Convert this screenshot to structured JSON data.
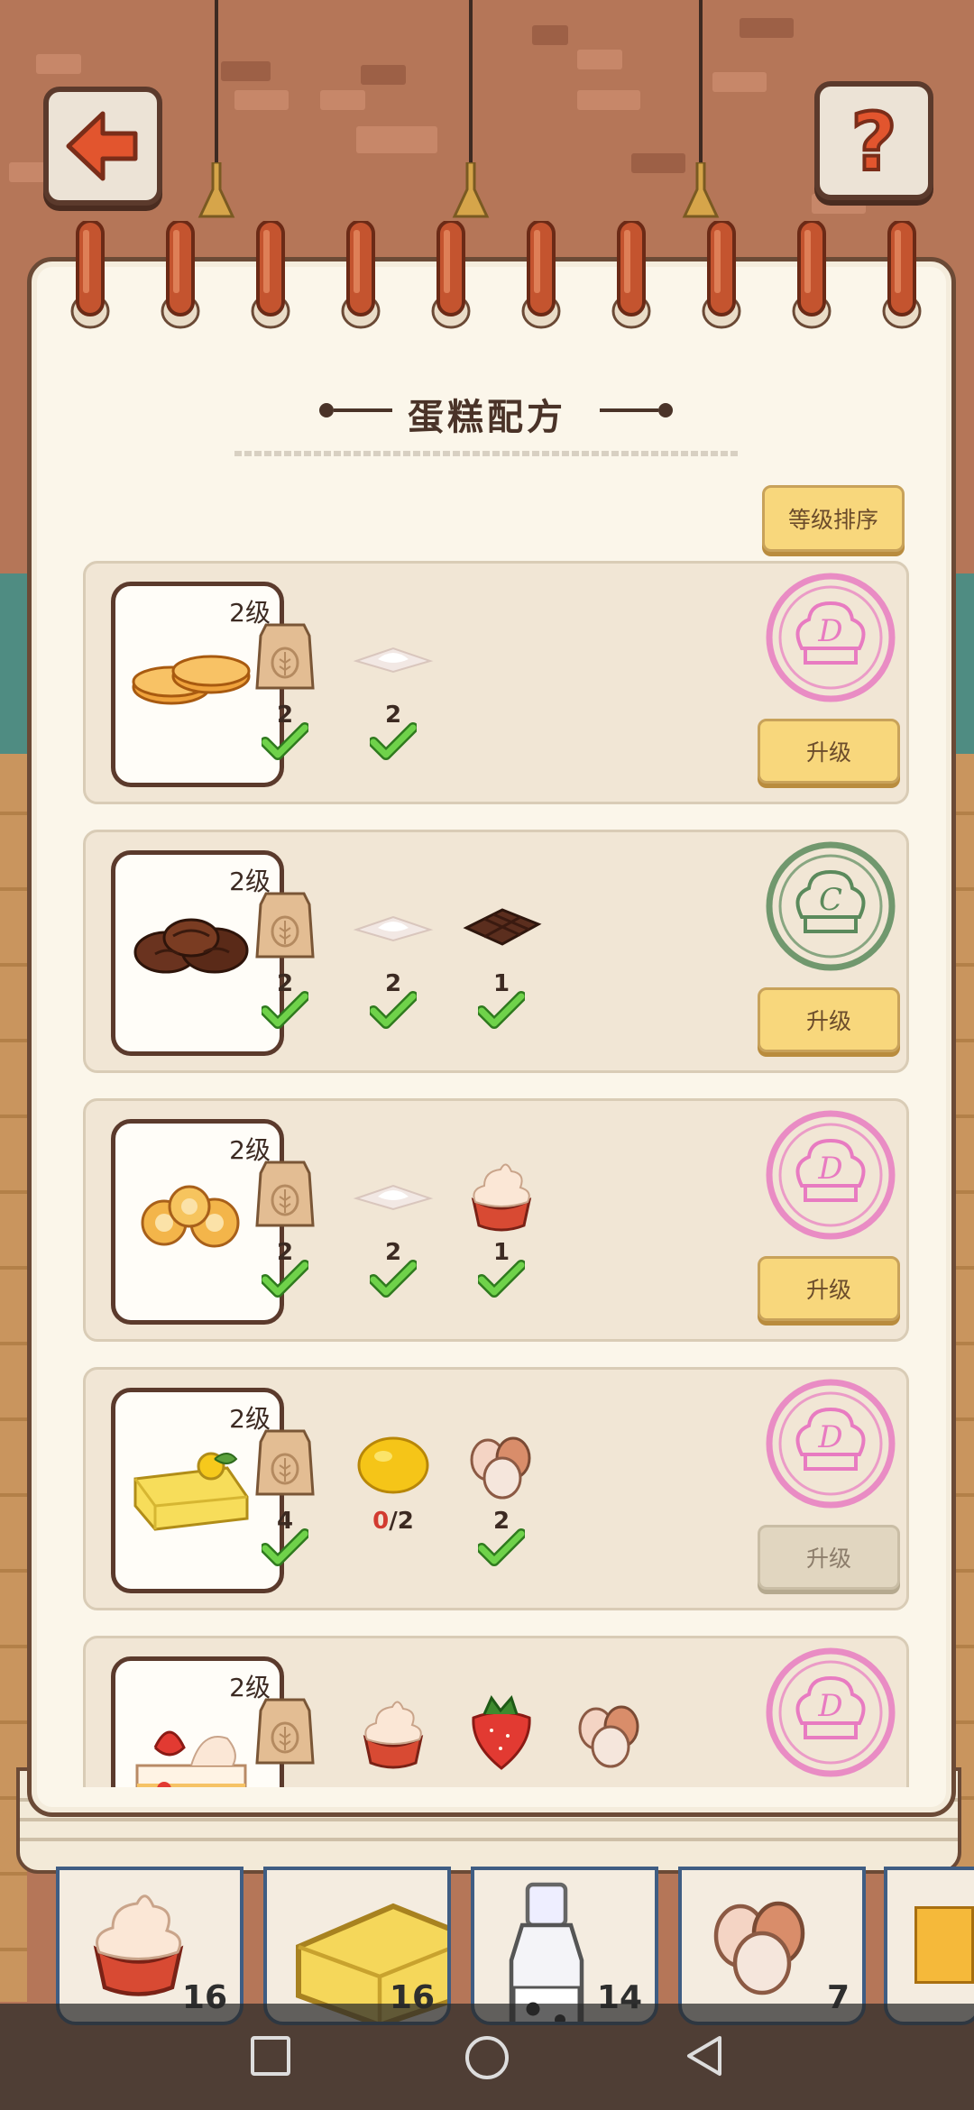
{
  "header": {
    "back_icon": "arrow-left-icon",
    "help_icon": "question-mark-icon",
    "title": "蛋糕配方"
  },
  "sort_button": "等级排序",
  "recipes": [
    {
      "level": "2级",
      "dish": "orange-sponge-cake-icon",
      "ingredients": [
        {
          "icon": "flour-bag-icon",
          "have": "2",
          "need": "",
          "ok": true
        },
        {
          "icon": "sugar-pile-icon",
          "have": "2",
          "need": "",
          "ok": true
        }
      ],
      "stamp": "D",
      "stamp_color": "#e87bc1",
      "button": "升级",
      "enabled": true
    },
    {
      "level": "2级",
      "dish": "chocolate-cookie-icon",
      "ingredients": [
        {
          "icon": "flour-bag-icon",
          "have": "2",
          "need": "",
          "ok": true
        },
        {
          "icon": "sugar-pile-icon",
          "have": "2",
          "need": "",
          "ok": true
        },
        {
          "icon": "chocolate-bar-icon",
          "have": "1",
          "need": "",
          "ok": true
        }
      ],
      "stamp": "C",
      "stamp_color": "#5b8a5c",
      "button": "升级",
      "enabled": true
    },
    {
      "level": "2级",
      "dish": "butter-cookie-icon",
      "ingredients": [
        {
          "icon": "flour-bag-icon",
          "have": "2",
          "need": "",
          "ok": true
        },
        {
          "icon": "sugar-pile-icon",
          "have": "2",
          "need": "",
          "ok": true
        },
        {
          "icon": "whipped-cream-icon",
          "have": "1",
          "need": "",
          "ok": true
        }
      ],
      "stamp": "D",
      "stamp_color": "#e87bc1",
      "button": "升级",
      "enabled": true
    },
    {
      "level": "2级",
      "dish": "lemon-cake-icon",
      "ingredients": [
        {
          "icon": "flour-bag-icon",
          "have": "4",
          "need": "",
          "ok": true
        },
        {
          "icon": "lemon-icon",
          "have": "0",
          "need": "/2",
          "ok": false
        },
        {
          "icon": "eggs-icon",
          "have": "2",
          "need": "",
          "ok": true
        }
      ],
      "stamp": "D",
      "stamp_color": "#e87bc1",
      "button": "升级",
      "enabled": false
    },
    {
      "level": "2级",
      "dish": "strawberry-shortcake-icon",
      "ingredients": [
        {
          "icon": "flour-bag-icon",
          "have": "",
          "need": "",
          "ok": false
        },
        {
          "icon": "whipped-cream-icon",
          "have": "",
          "need": "",
          "ok": false
        },
        {
          "icon": "strawberry-icon",
          "have": "",
          "need": "",
          "ok": false
        },
        {
          "icon": "eggs-icon",
          "have": "",
          "need": "",
          "ok": false
        }
      ],
      "stamp": "D",
      "stamp_color": "#e87bc1",
      "button": "",
      "enabled": true
    }
  ],
  "inventory": [
    {
      "icon": "whipped-cream-icon",
      "count": "16"
    },
    {
      "icon": "butter-block-icon",
      "count": "16"
    },
    {
      "icon": "milk-bottle-icon",
      "count": "14"
    },
    {
      "icon": "eggs-icon",
      "count": "7"
    }
  ],
  "navbar": [
    "recent-apps-icon",
    "home-icon",
    "back-icon"
  ]
}
